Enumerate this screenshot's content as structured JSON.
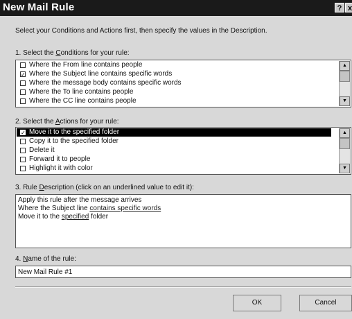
{
  "window": {
    "title": "New Mail Rule",
    "help_label": "?",
    "close_label": "x"
  },
  "intro": "Select your Conditions and Actions first, then specify the values in the Description.",
  "conditions": {
    "header_pre": "1. Select the ",
    "header_key": "C",
    "header_post": "onditions for your rule:",
    "items": [
      {
        "label": "Where the From line contains people",
        "checked": false
      },
      {
        "label": "Where the Subject line contains specific words",
        "checked": true
      },
      {
        "label": "Where the message body contains specific words",
        "checked": false
      },
      {
        "label": "Where the To line contains people",
        "checked": false
      },
      {
        "label": "Where the CC line contains people",
        "checked": false
      }
    ]
  },
  "actions": {
    "header_pre": "2. Select the ",
    "header_key": "A",
    "header_post": "ctions for your rule:",
    "items": [
      {
        "label": "Move it to the specified folder",
        "checked": true,
        "selected": true
      },
      {
        "label": "Copy it to the specified folder",
        "checked": false
      },
      {
        "label": "Delete it",
        "checked": false
      },
      {
        "label": "Forward it to people",
        "checked": false
      },
      {
        "label": "Highlight it with color",
        "checked": false
      }
    ]
  },
  "description": {
    "header_pre": "3. Rule ",
    "header_key": "D",
    "header_post": "escription (click on an underlined value to edit it):",
    "line1": "Apply this rule after the message arrives",
    "line2_pre": "Where the Subject line ",
    "line2_link": "contains specific words",
    "line3_pre": "Move it to the ",
    "line3_link": "specified",
    "line3_post": " folder"
  },
  "name": {
    "header_pre": "4. ",
    "header_key": "N",
    "header_post": "ame of the rule:",
    "value": "New Mail Rule #1"
  },
  "buttons": {
    "ok": "OK",
    "cancel": "Cancel"
  },
  "icons": {
    "checkmark": "✓",
    "scroll_up": "▲",
    "scroll_down": "▼"
  }
}
